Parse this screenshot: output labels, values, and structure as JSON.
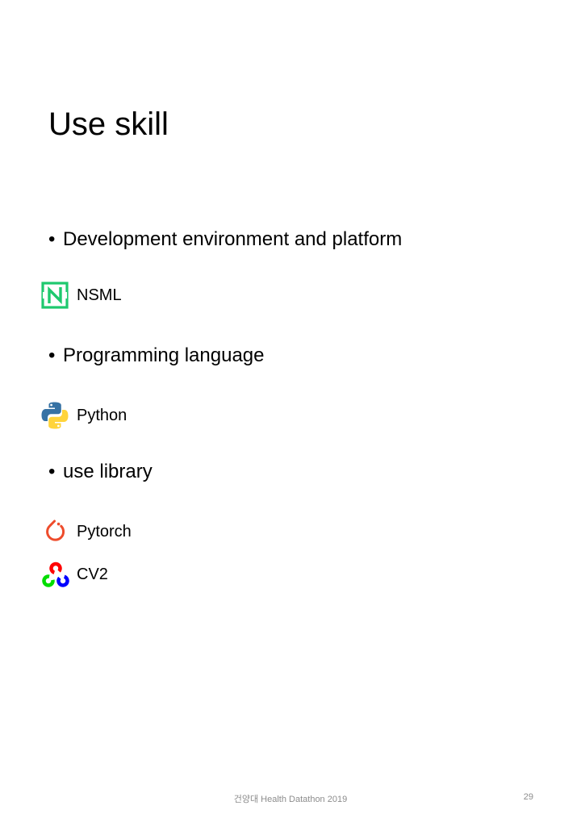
{
  "slide": {
    "title": "Use skill",
    "sections": [
      {
        "bullet": "•",
        "heading": "Development environment and platform",
        "items": [
          {
            "label": "NSML",
            "icon": "nsml-logo-icon"
          }
        ]
      },
      {
        "bullet": "•",
        "heading": "Programming language",
        "items": [
          {
            "label": "Python",
            "icon": "python-logo-icon"
          }
        ]
      },
      {
        "bullet": "•",
        "heading": "use library",
        "items": [
          {
            "label": "Pytorch",
            "icon": "pytorch-logo-icon"
          },
          {
            "label": "CV2",
            "icon": "opencv-logo-icon"
          }
        ]
      }
    ],
    "footer": "건양대 Health Datathon 2019",
    "page_number": "29"
  },
  "colors": {
    "nsml_green": "#1ec96e",
    "python_blue": "#3772a4",
    "python_yellow": "#ffd43b",
    "pytorch_orange": "#ee4c2c",
    "opencv_red": "#ff0000",
    "opencv_green": "#00dd00",
    "opencv_blue": "#0000ff",
    "footer_gray": "#8c8c8c"
  }
}
